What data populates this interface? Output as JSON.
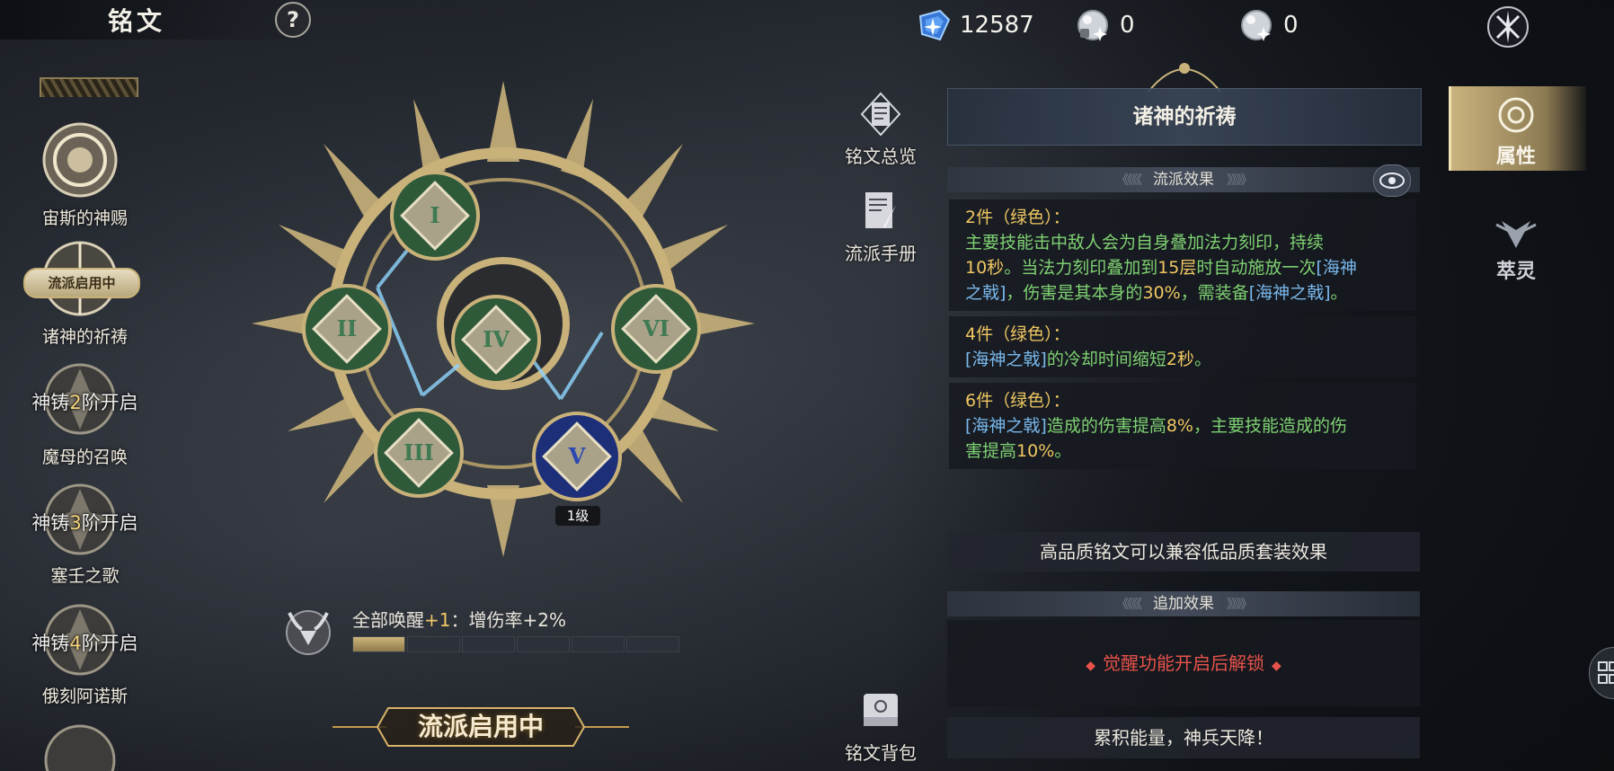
{
  "header": {
    "title": "铭文",
    "help": "?",
    "resources": [
      {
        "icon": "blue-crystal-icon",
        "value": "12587"
      },
      {
        "icon": "silver-orb-icon",
        "value": "0"
      },
      {
        "icon": "silver-orb-icon",
        "value": "0"
      }
    ],
    "close_icon": "crossed-blades-close-icon"
  },
  "sets": [
    {
      "name": "宙斯的神赐",
      "locked_text": null
    },
    {
      "name": "诸神的祈祷",
      "active_tag": "流派启用中"
    },
    {
      "name": "魔母的召唤",
      "lock_prefix": "神铸",
      "lock_num": "2",
      "lock_suffix": "阶开启"
    },
    {
      "name": "塞壬之歌",
      "lock_prefix": "神铸",
      "lock_num": "3",
      "lock_suffix": "阶开启"
    },
    {
      "name": "俄刻阿诺斯",
      "lock_prefix": "神铸",
      "lock_num": "4",
      "lock_suffix": "阶开启"
    }
  ],
  "wheel": {
    "nodes": [
      "I",
      "II",
      "III",
      "IV",
      "V",
      "VI"
    ],
    "level_label": "1级"
  },
  "awaken": {
    "prefix": "全部唤醒",
    "bonus": "+1",
    "suffix": "：增伤率+2%",
    "progress_segments": 6,
    "progress_filled": 1
  },
  "school_button": "流派启用中",
  "mid_buttons": {
    "overview": "铭文总览",
    "manual": "流派手册",
    "bag": "铭文背包"
  },
  "panel": {
    "set_name": "诸神的祈祷",
    "effect_header": "流派效果",
    "effects": [
      {
        "title": "2件（绿色）：",
        "lines": [
          [
            {
              "t": "主要技能击中敌人会为自身叠加法力刻印，持续",
              "c": "t"
            }
          ],
          [
            {
              "t": "10秒",
              "c": "y"
            },
            {
              "t": "。当法力刻印叠加到",
              "c": "t"
            },
            {
              "t": "15层",
              "c": "y"
            },
            {
              "t": "时自动施放一次",
              "c": "t"
            },
            {
              "t": "[海神",
              "c": "b"
            }
          ],
          [
            {
              "t": "之戟]",
              "c": "b"
            },
            {
              "t": "，伤害是其本身的",
              "c": "t"
            },
            {
              "t": "30%",
              "c": "y"
            },
            {
              "t": "，需装备",
              "c": "t"
            },
            {
              "t": "[海神之戟]",
              "c": "b"
            },
            {
              "t": "。",
              "c": "t"
            }
          ]
        ]
      },
      {
        "title": "4件（绿色）：",
        "lines": [
          [
            {
              "t": "[海神之戟]",
              "c": "b"
            },
            {
              "t": "的冷却时间缩短",
              "c": "t"
            },
            {
              "t": "2秒",
              "c": "y"
            },
            {
              "t": "。",
              "c": "t"
            }
          ]
        ]
      },
      {
        "title": "6件（绿色）：",
        "lines": [
          [
            {
              "t": "[海神之戟]",
              "c": "b"
            },
            {
              "t": "造成的伤害提高",
              "c": "t"
            },
            {
              "t": "8%",
              "c": "y"
            },
            {
              "t": "，主要技能造成的伤",
              "c": "t"
            }
          ],
          [
            {
              "t": "害提高",
              "c": "t"
            },
            {
              "t": "10%",
              "c": "y"
            },
            {
              "t": "。",
              "c": "t"
            }
          ]
        ]
      }
    ],
    "compat_note": "高品质铭文可以兼容低品质套装效果",
    "extra_header": "追加效果",
    "locked_text": "觉醒功能开启后解锁",
    "footer": "累积能量，神兵天降！"
  },
  "tabs": {
    "attributes": "属性",
    "spirit": "萃灵"
  },
  "colors": {
    "green_text": "#7fd172",
    "yellow_text": "#f0c762",
    "blue_text": "#79b8ec",
    "locked_red": "#e6524a",
    "gold": "#c9b37e"
  }
}
